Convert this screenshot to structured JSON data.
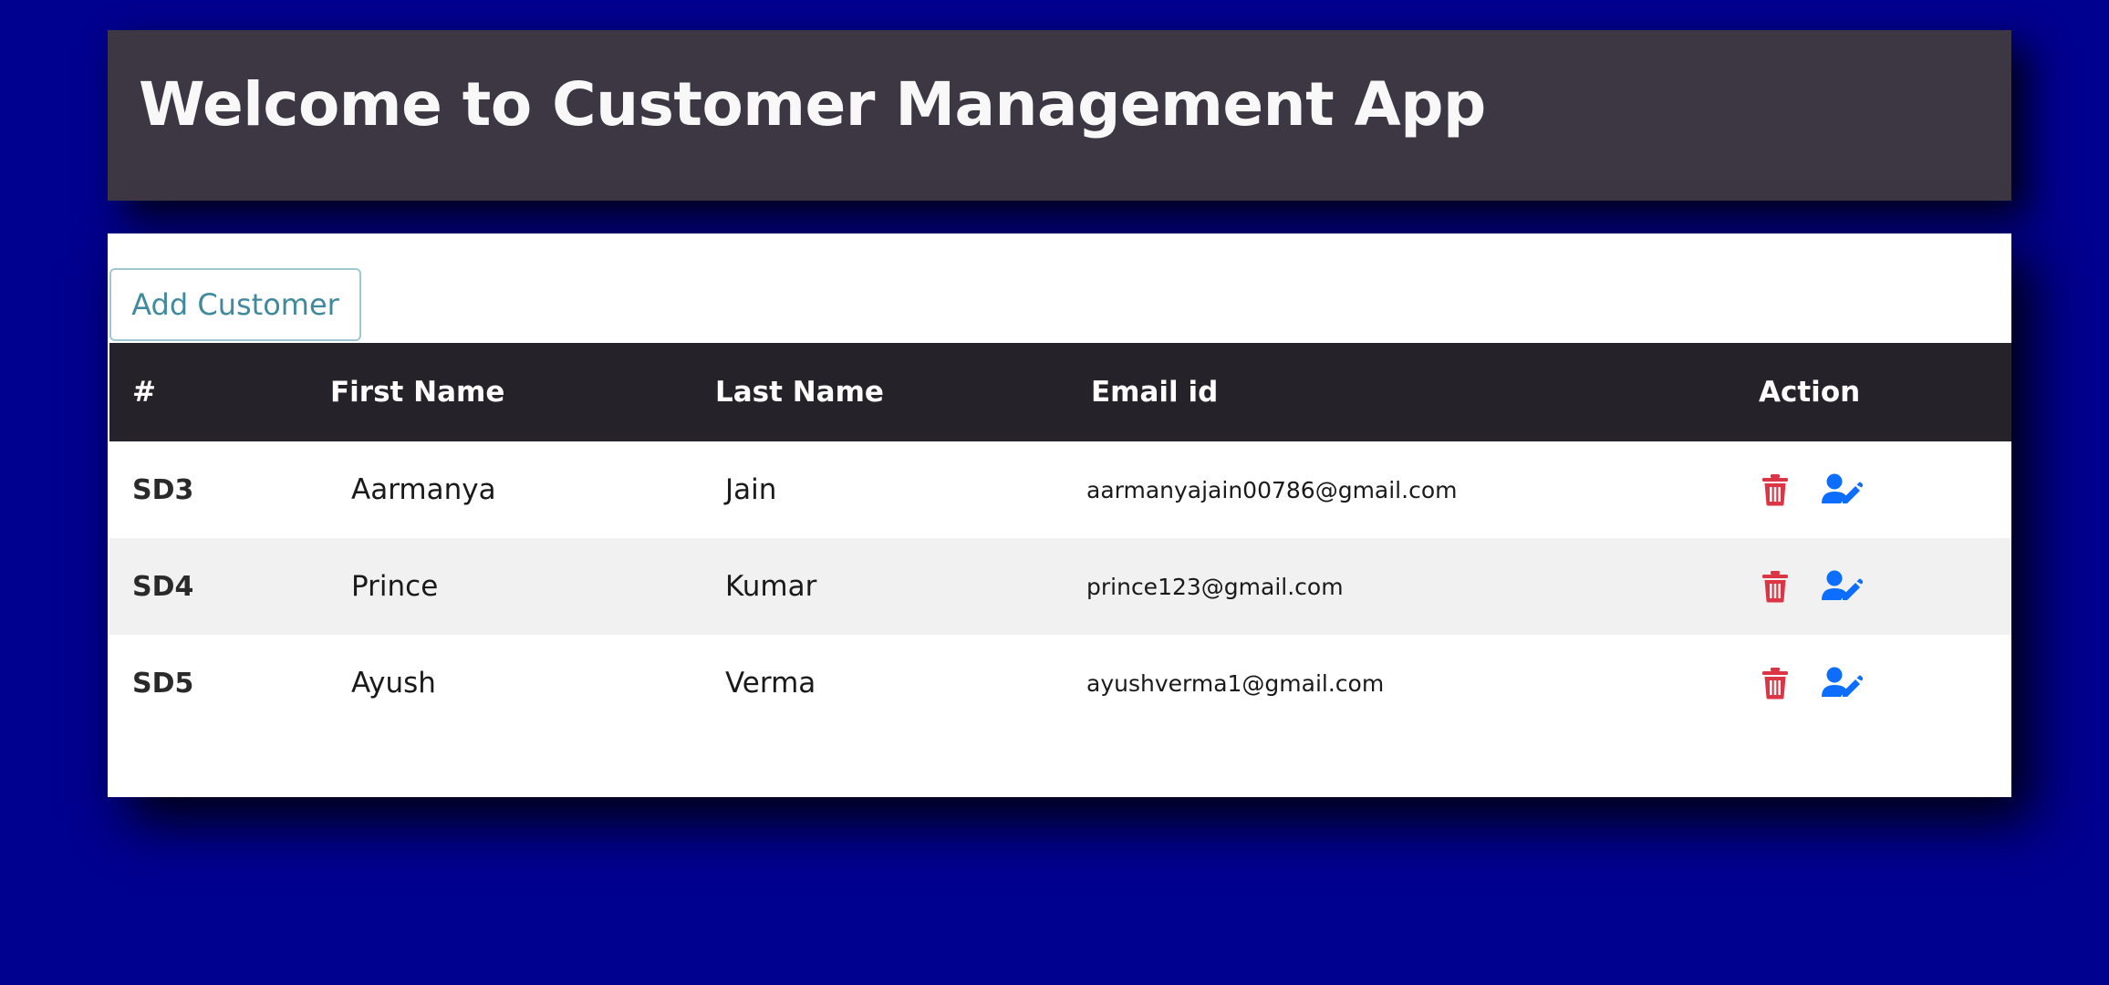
{
  "header": {
    "title": "Welcome to Customer Management App"
  },
  "toolbar": {
    "add_label": "Add Customer"
  },
  "table": {
    "columns": [
      "#",
      "First Name",
      "Last Name",
      "Email id",
      "Action"
    ],
    "rows": [
      {
        "id": "SD3",
        "first": "Aarmanya",
        "last": "Jain",
        "email": "aarmanyajain00786@gmail.com"
      },
      {
        "id": "SD4",
        "first": "Prince",
        "last": "Kumar",
        "email": "prince123@gmail.com"
      },
      {
        "id": "SD5",
        "first": "Ayush",
        "last": "Verma",
        "email": "ayushverma1@gmail.com"
      }
    ],
    "row_actions": [
      "trash-icon",
      "user-edit-icon"
    ]
  },
  "colors": {
    "background": "#01018f",
    "header_bg": "#3d3643",
    "table_head_bg": "#26222a",
    "delete": "#dc3545",
    "edit": "#0d6efd",
    "add_button_text": "#3f8a9c"
  }
}
